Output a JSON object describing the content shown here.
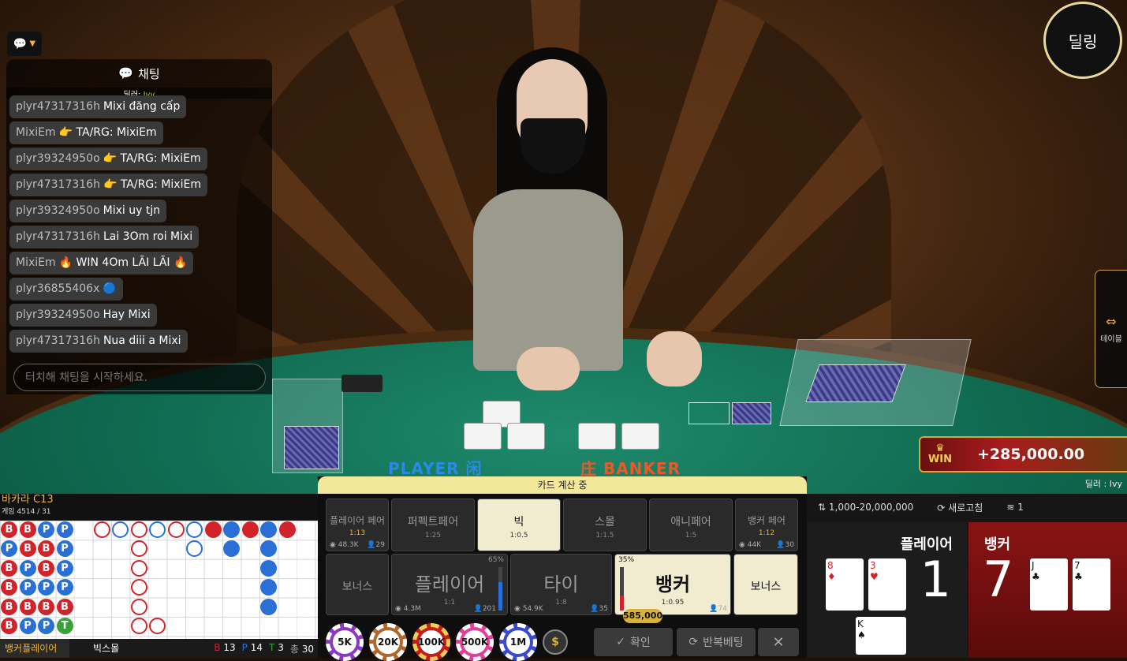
{
  "top": {
    "dealing_button": "딜링",
    "side_tab_label": "테이블"
  },
  "chat": {
    "title": "채팅",
    "dealer_label": "딜러:",
    "dealer_name": "Ivy",
    "messages": [
      {
        "user": "plyr47317316h",
        "text": "Mixi đăng cấp"
      },
      {
        "user": "MixiEm",
        "text": "👉 TA/RG: MixiEm"
      },
      {
        "user": "plyr39324950o",
        "text": "👉 TA/RG: MixiEm"
      },
      {
        "user": "plyr47317316h",
        "text": "👉 TA/RG: MixiEm"
      },
      {
        "user": "plyr39324950o",
        "text": "Mixi uy tjn"
      },
      {
        "user": "plyr47317316h",
        "text": "Lai 3Om roi Mixi"
      },
      {
        "user": "MixiEm",
        "text": "🔥 WIN 4Om LÃI LÃI 🔥"
      },
      {
        "user": "plyr36855406x",
        "text": "🔵"
      },
      {
        "user": "plyr39324950o",
        "text": "Hay Mixi"
      },
      {
        "user": "plyr47317316h",
        "text": "Nua diii a Mixi"
      }
    ],
    "input_placeholder": "터치해 채팅을 시작하세요."
  },
  "table_labels": {
    "player": "PLAYER 闲",
    "banker": "庄 BANKER"
  },
  "win_banner": {
    "label": "WIN",
    "amount": "+285,000.00"
  },
  "dealer_tag": "딜러 : Ivy",
  "game": {
    "name": "바카라 C13",
    "round": "게임 4514 / 31",
    "tabs": [
      "뱅커플레이어",
      "빅스몰"
    ],
    "stats": {
      "b_label": "B",
      "b": "13",
      "p_label": "P",
      "p": "14",
      "t_label": "T",
      "t": "3",
      "total_label": "총",
      "total": "30"
    }
  },
  "bet": {
    "status": "카드 계산 중",
    "top_row": [
      {
        "name": "플레이어 페어",
        "odds": "1:13",
        "pool": "48.3K",
        "count": "29"
      },
      {
        "name": "퍼펙트페어",
        "odds": "1:25"
      },
      {
        "name": "빅",
        "odds": "1:0.5"
      },
      {
        "name": "스몰",
        "odds": "1:1.5"
      },
      {
        "name": "애니페어",
        "odds": "1:5"
      },
      {
        "name": "뱅커 페어",
        "odds": "1:12",
        "pool": "44K",
        "count": "30"
      }
    ],
    "bottom_row": [
      {
        "name": "보너스"
      },
      {
        "name": "플레이어",
        "odds": "1:1",
        "pool": "4.3M",
        "count": "201",
        "pct": "65%"
      },
      {
        "name": "타이",
        "odds": "1:8",
        "pool": "54.9K",
        "count": "35"
      },
      {
        "name": "뱅커",
        "odds": "1:0.95",
        "count": "74",
        "pct": "35%"
      },
      {
        "name": "보너스"
      }
    ],
    "placed_amount": "585,000",
    "chips": [
      "5K",
      "20K",
      "100K",
      "500K",
      "1M"
    ],
    "confirm": "확인",
    "repeat": "반복베팅"
  },
  "right": {
    "limit": "1,000-20,000,000",
    "refresh": "새로고침",
    "signal": "1",
    "player_label": "플레이어",
    "player_score": "1",
    "banker_label": "뱅커",
    "banker_score": "7"
  }
}
